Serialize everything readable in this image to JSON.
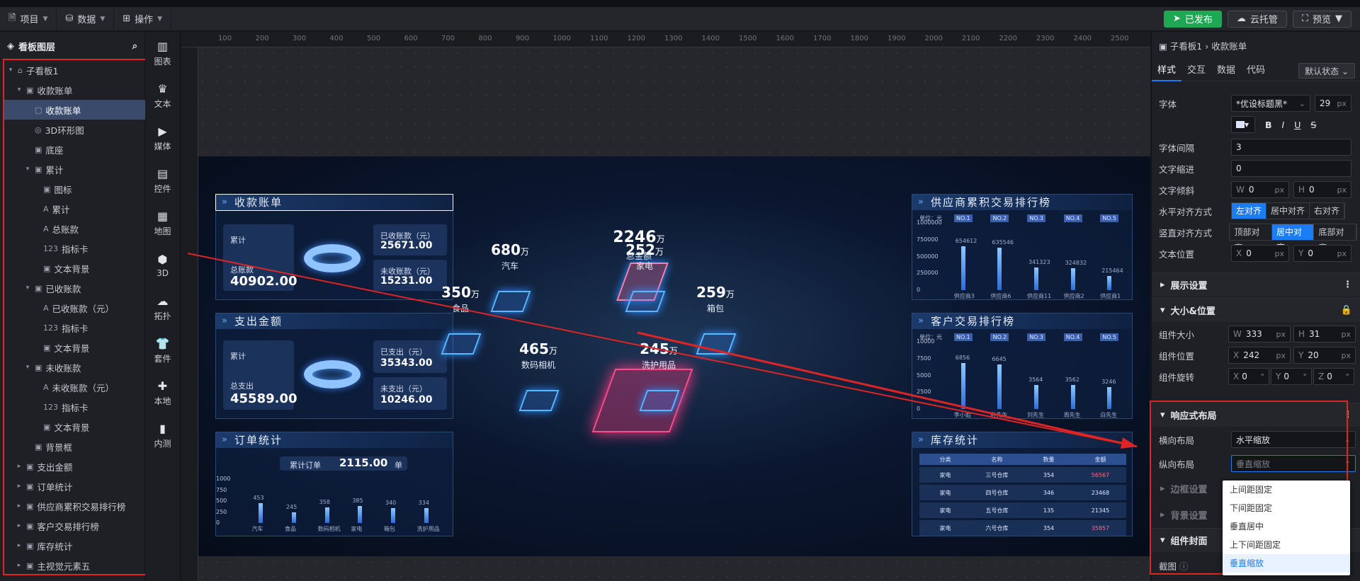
{
  "toolbar": {
    "menus": [
      "项目",
      "数据",
      "操作"
    ],
    "published": "已发布",
    "cloud": "云托管",
    "preview": "预览"
  },
  "layers": {
    "title": "看板图层",
    "items": [
      {
        "label": "子看板1",
        "depth": 0,
        "expand": "▾",
        "icon": "⌂"
      },
      {
        "label": "收款账单",
        "depth": 1,
        "expand": "▾",
        "icon": "▣"
      },
      {
        "label": "收款账单",
        "depth": 2,
        "expand": "",
        "icon": "▢",
        "selected": true
      },
      {
        "label": "3D环形图",
        "depth": 2,
        "expand": "",
        "icon": "◎"
      },
      {
        "label": "底座",
        "depth": 2,
        "expand": "",
        "icon": "▣"
      },
      {
        "label": "累计",
        "depth": 2,
        "expand": "▾",
        "icon": "▣"
      },
      {
        "label": "图标",
        "depth": 3,
        "expand": "",
        "icon": "▣"
      },
      {
        "label": "累计",
        "depth": 3,
        "expand": "",
        "icon": "A"
      },
      {
        "label": "总账款",
        "depth": 3,
        "expand": "",
        "icon": "A"
      },
      {
        "label": "指标卡",
        "depth": 3,
        "expand": "",
        "icon": "123"
      },
      {
        "label": "文本背景",
        "depth": 3,
        "expand": "",
        "icon": "▣"
      },
      {
        "label": "已收账款",
        "depth": 2,
        "expand": "▾",
        "icon": "▣"
      },
      {
        "label": "已收账款（元）",
        "depth": 3,
        "expand": "",
        "icon": "A"
      },
      {
        "label": "指标卡",
        "depth": 3,
        "expand": "",
        "icon": "123"
      },
      {
        "label": "文本背景",
        "depth": 3,
        "expand": "",
        "icon": "▣"
      },
      {
        "label": "未收账款",
        "depth": 2,
        "expand": "▾",
        "icon": "▣"
      },
      {
        "label": "未收账款（元）",
        "depth": 3,
        "expand": "",
        "icon": "A"
      },
      {
        "label": "指标卡",
        "depth": 3,
        "expand": "",
        "icon": "123"
      },
      {
        "label": "文本背景",
        "depth": 3,
        "expand": "",
        "icon": "▣"
      },
      {
        "label": "背景框",
        "depth": 2,
        "expand": "",
        "icon": "▣"
      },
      {
        "label": "支出金额",
        "depth": 1,
        "expand": "▸",
        "icon": "▣"
      },
      {
        "label": "订单统计",
        "depth": 1,
        "expand": "▸",
        "icon": "▣"
      },
      {
        "label": "供应商累积交易排行榜",
        "depth": 1,
        "expand": "▸",
        "icon": "▣"
      },
      {
        "label": "客户交易排行榜",
        "depth": 1,
        "expand": "▸",
        "icon": "▣"
      },
      {
        "label": "库存统计",
        "depth": 1,
        "expand": "▸",
        "icon": "▣"
      },
      {
        "label": "主视觉元素五",
        "depth": 1,
        "expand": "▸",
        "icon": "▣"
      }
    ]
  },
  "charts": [
    "图表",
    "文本",
    "媒体",
    "控件",
    "地图",
    "3D",
    "拓扑",
    "套件",
    "本地",
    "内测"
  ],
  "ruler": [
    "100",
    "200",
    "300",
    "400",
    "500",
    "600",
    "700",
    "800",
    "900",
    "1000",
    "1100",
    "1200",
    "1300",
    "1400",
    "1500",
    "1600",
    "1700",
    "1800",
    "1900",
    "2000",
    "2100",
    "2200",
    "2300",
    "2400",
    "2500"
  ],
  "board": {
    "receipt": {
      "title": "收款账单",
      "acc": "累计",
      "total_label": "总账款",
      "total": "40902.00",
      "got_label": "已收账款（元）",
      "got": "25671.00",
      "un_label": "未收账款（元）",
      "un": "15231.00"
    },
    "expense": {
      "title": "支出金额",
      "acc": "累计",
      "total_label": "总支出",
      "total": "45589.00",
      "got_label": "已支出（元）",
      "got": "35343.00",
      "un_label": "未支出（元）",
      "un": "10246.00"
    },
    "order": {
      "title": "订单统计",
      "acc_label": "累计订单",
      "acc": "2115.00",
      "unit": "单",
      "ticks": [
        "1000",
        "750",
        "500",
        "250",
        "0"
      ],
      "chart": {
        "type": "bar",
        "categories": [
          "汽车",
          "食品",
          "数码相机",
          "家电",
          "箱包",
          "洗护用品"
        ],
        "values": [
          453,
          245,
          358,
          385,
          340,
          334
        ],
        "ylim": [
          0,
          1000
        ]
      }
    },
    "center": {
      "total": "2246",
      "total_unit": "万",
      "total_label": "总金额",
      "items": [
        {
          "v": "680",
          "u": "万",
          "l": "汽车"
        },
        {
          "v": "252",
          "u": "万",
          "l": "家电"
        },
        {
          "v": "350",
          "u": "万",
          "l": "食品"
        },
        {
          "v": "259",
          "u": "万",
          "l": "箱包"
        },
        {
          "v": "465",
          "u": "万",
          "l": "数码相机"
        },
        {
          "v": "245",
          "u": "万",
          "l": "洗护用品"
        }
      ]
    },
    "supplier": {
      "title": "供应商累积交易排行榜",
      "unit": "单位：元",
      "ranks": [
        "NO.1",
        "NO.2",
        "NO.3",
        "NO.4",
        "NO.5"
      ],
      "ticks": [
        "1000000",
        "750000",
        "500000",
        "250000",
        "0"
      ],
      "chart": {
        "type": "bar",
        "categories": [
          "供应商3",
          "供应商6",
          "供应商11",
          "供应商2",
          "供应商1"
        ],
        "values": [
          654612,
          635546,
          341323,
          324832,
          215464
        ],
        "ylim": [
          0,
          1000000
        ]
      },
      "labels": [
        "654612",
        "635546",
        "341323",
        "324832",
        "215464"
      ]
    },
    "customer": {
      "title": "客户交易排行榜",
      "unit": "单位：元",
      "ranks": [
        "NO.1",
        "NO.2",
        "NO.3",
        "NO.4",
        "NO.5"
      ],
      "ticks": [
        "10000",
        "7500",
        "5000",
        "2500",
        "0"
      ],
      "chart": {
        "type": "bar",
        "categories": [
          "李小姐",
          "孙先生",
          "刘先生",
          "周先生",
          "白先生"
        ],
        "values": [
          6856,
          6645,
          3564,
          3562,
          3246
        ],
        "ylim": [
          0,
          10000
        ]
      },
      "labels": [
        "6856",
        "6645",
        "3564",
        "3562",
        "3246"
      ]
    },
    "stock": {
      "title": "库存统计",
      "headers": [
        "分类",
        "名称",
        "数量",
        "金额"
      ],
      "rows": [
        [
          "家电",
          "三号仓库",
          "354",
          "56567"
        ],
        [
          "家电",
          "四号仓库",
          "346",
          "23468"
        ],
        [
          "家电",
          "五号仓库",
          "135",
          "21345"
        ],
        [
          "家电",
          "六号仓库",
          "354",
          "35857"
        ]
      ]
    }
  },
  "props": {
    "crumb": "子看板1 › 收款账单",
    "tabs": [
      "样式",
      "交互",
      "数据",
      "代码"
    ],
    "state": "默认状态",
    "font_label": "字体",
    "font": "*优设标题黑*",
    "font_size": "29",
    "px": "px",
    "spacing_label": "字体间隔",
    "spacing": "3",
    "indent_label": "文字缩进",
    "indent": "0",
    "skew_label": "文字倾斜",
    "skew_w": "0",
    "skew_h": "0",
    "halign_label": "水平对齐方式",
    "halign": [
      "左对齐",
      "居中对齐",
      "右对齐"
    ],
    "valign_label": "竖直对齐方式",
    "valign": [
      "顶部对齐",
      "居中对齐",
      "底部对齐"
    ],
    "pos_label": "文本位置",
    "pos_x": "0",
    "pos_y": "0",
    "display": "展示设置",
    "size_section": "大小&位置",
    "size_label": "组件大小",
    "w": "333",
    "h": "31",
    "position_label": "组件位置",
    "x": "242",
    "y": "20",
    "rot_label": "组件旋转",
    "rx": "0",
    "ry": "0",
    "rz": "0",
    "deg": "°",
    "resp": "响应式布局",
    "h_layout_label": "横向布局",
    "h_layout": "水平缩放",
    "v_layout_label": "纵向布局",
    "v_layout": "垂直缩放",
    "border": "边框设置",
    "bg": "背景设置",
    "cover": "组件封面",
    "screenshot": "截图",
    "options": [
      "上间距固定",
      "下间距固定",
      "垂直居中",
      "上下间距固定",
      "垂直缩放"
    ]
  }
}
